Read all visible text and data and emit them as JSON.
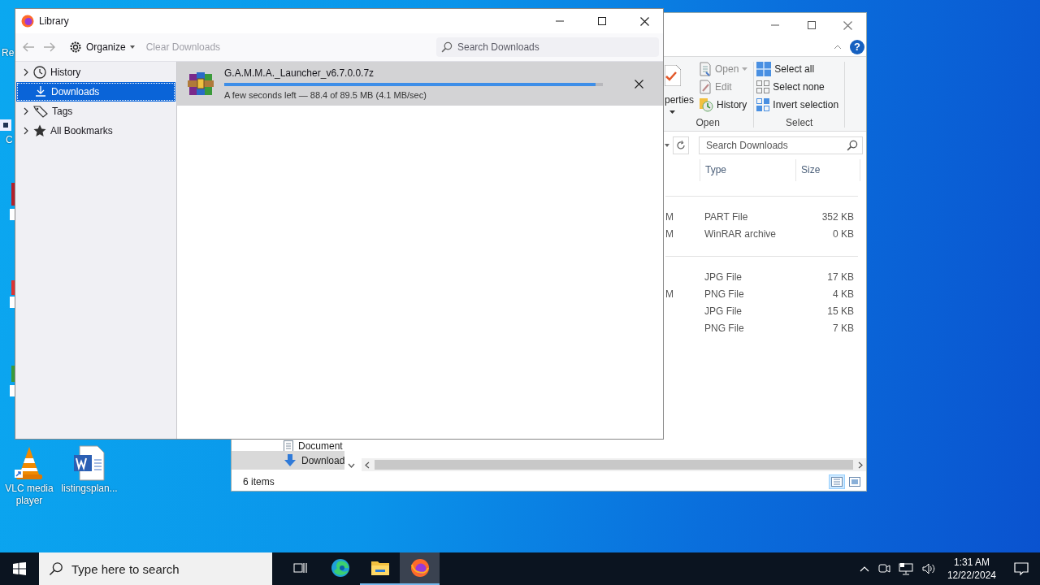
{
  "desktop": {
    "icons": [
      {
        "kind": "partial_recycle",
        "label": "Re"
      },
      {
        "kind": "partial_shortcut",
        "label": "C"
      },
      {
        "kind": "vlc",
        "label": "VLC media player"
      },
      {
        "kind": "word",
        "label": "listingsplan..."
      }
    ]
  },
  "explorer": {
    "ribbon": {
      "properties_label": "perties",
      "open_group": {
        "label": "Open",
        "items": [
          {
            "kind": "open",
            "label": "Open",
            "disabled": true,
            "has_menu": true
          },
          {
            "kind": "edit",
            "label": "Edit",
            "disabled": true,
            "has_menu": false
          },
          {
            "kind": "history",
            "label": "History",
            "disabled": false,
            "has_menu": false
          }
        ]
      },
      "select_group": {
        "label": "Select",
        "items": [
          {
            "kind": "select_all",
            "label": "Select all"
          },
          {
            "kind": "select_none",
            "label": "Select none"
          },
          {
            "kind": "invert",
            "label": "Invert selection"
          }
        ]
      },
      "help_label": "?"
    },
    "search": {
      "placeholder": "Search Downloads"
    },
    "columns": [
      "Type",
      "Size"
    ],
    "groups": [
      {
        "rows": [
          {
            "date": "M",
            "type": "PART File",
            "size": "352 KB"
          },
          {
            "date": "M",
            "type": "WinRAR archive",
            "size": "0 KB"
          }
        ]
      },
      {
        "rows": [
          {
            "type": "JPG File",
            "size": "17 KB"
          },
          {
            "date": "M",
            "type": "PNG File",
            "size": "4 KB"
          },
          {
            "type": "JPG File",
            "size": "15 KB"
          },
          {
            "type": "PNG File",
            "size": "7 KB"
          }
        ]
      }
    ],
    "nav": [
      {
        "kind": "document",
        "label": "Document",
        "selected": false
      },
      {
        "kind": "download",
        "label": "Download",
        "selected": true
      }
    ],
    "status": "6 items",
    "view_buttons": [
      {
        "kind": "details",
        "selected": true
      },
      {
        "kind": "large_icons",
        "selected": false
      }
    ]
  },
  "library": {
    "title": "Library",
    "toolbar": {
      "organize": "Organize",
      "clear": {
        "label": "Clear Downloads",
        "disabled": true
      }
    },
    "search": {
      "placeholder": "Search Downloads"
    },
    "sidebar": [
      {
        "kind": "history",
        "label": "History",
        "expandable": true,
        "selected": false
      },
      {
        "kind": "downloads",
        "label": "Downloads",
        "expandable": false,
        "selected": true
      },
      {
        "kind": "tags",
        "label": "Tags",
        "expandable": true,
        "selected": false
      },
      {
        "kind": "bookmarks",
        "label": "All Bookmarks",
        "expandable": true,
        "selected": false
      }
    ],
    "downloads": [
      {
        "name": "G.A.M.M.A._Launcher_v6.7.0.0.7z",
        "level": 0.98,
        "status": "A few seconds left — 88.4 of 89.5 MB (4.1 MB/sec)",
        "selected": true
      }
    ]
  },
  "taskbar": {
    "search_placeholder": "Type here to search",
    "apps": [
      {
        "kind": "task_view",
        "running": false,
        "active": false
      },
      {
        "kind": "edge",
        "running": false,
        "active": false
      },
      {
        "kind": "explorer",
        "running": true,
        "active": false
      },
      {
        "kind": "firefox",
        "running": true,
        "active": true
      }
    ],
    "time": "1:31 AM",
    "date": "12/22/2024"
  }
}
